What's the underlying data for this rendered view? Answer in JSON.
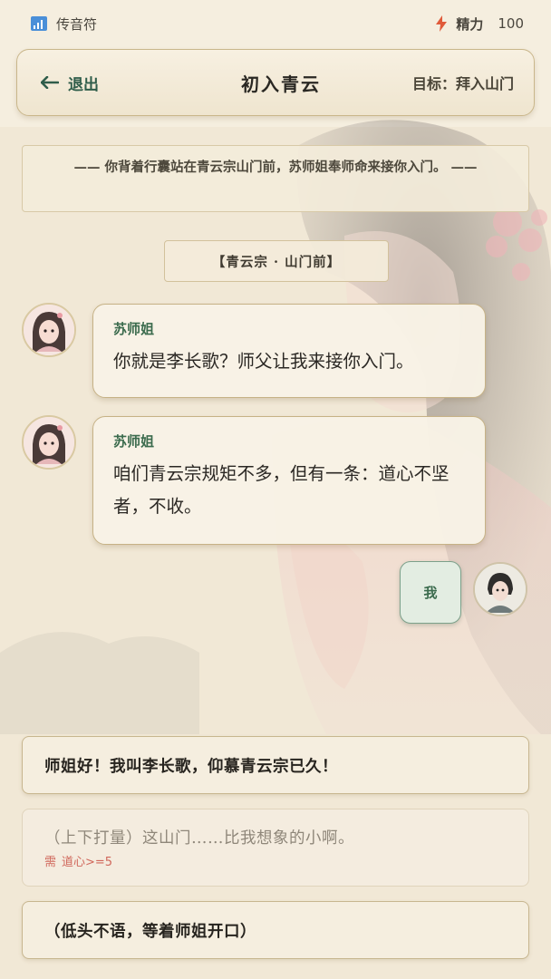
{
  "status_bar": {
    "signal_label": "传音符",
    "energy_label": "精力",
    "energy_value": "100"
  },
  "header": {
    "back_label": "退出",
    "title": "初入青云",
    "goal_label": "目标：拜入山门"
  },
  "narration": "—— 你背着行囊站在青云宗山门前，苏师姐奉师命来接你入门。 ——",
  "location": "【青云宗 · 山门前】",
  "messages": [
    {
      "speaker": "苏师姐",
      "text": "你就是李长歌？师父让我来接你入门。"
    },
    {
      "speaker": "苏师姐",
      "text": "咱们青云宗规矩不多，但有一条：道心不坚者，不收。"
    }
  ],
  "player_bubble": "我",
  "choices": [
    {
      "label": "师姐好！我叫李长歌，仰慕青云宗已久！",
      "enabled": true
    },
    {
      "label": "（上下打量）这山门……比我想象的小啊。",
      "enabled": false,
      "requirement_prefix": "需",
      "requirement": "道心>=5"
    },
    {
      "label": "（低头不语，等着师姐开口）",
      "enabled": true
    }
  ],
  "colors": {
    "accent_green": "#3b6b4d",
    "energy_red": "#e05a3a",
    "signal_blue": "#4a8fd8",
    "requirement_red": "#d0675b"
  },
  "icons": {
    "signal": "signal-bars-icon",
    "energy": "lightning-icon",
    "back": "arrow-left-icon"
  }
}
